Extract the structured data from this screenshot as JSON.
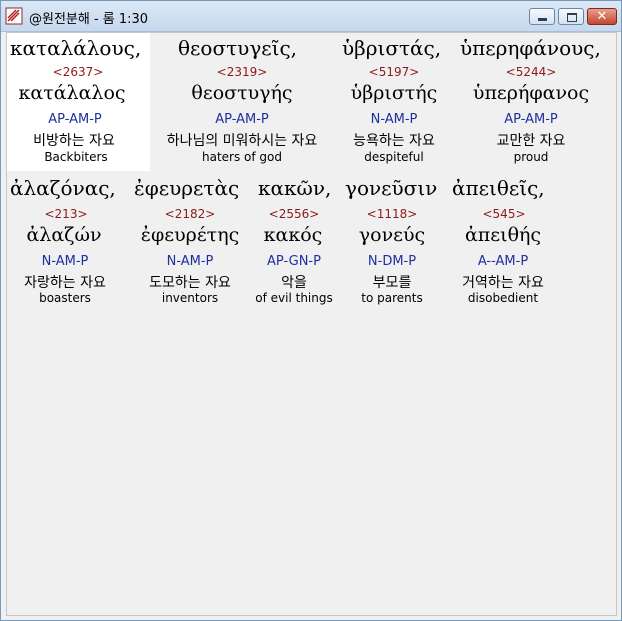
{
  "window": {
    "title": "@원전분해 - 롬 1:30",
    "close_glyph": "✕"
  },
  "words": [
    {
      "greek": "καταλάλους,",
      "strong": "<2637>",
      "lemma": "κατάλαλος",
      "morph": "AP-AM-P",
      "korean": "비방하는 자요",
      "english": "Backbiters"
    },
    {
      "greek": "θεοστυγεῖς,",
      "strong": "<2319>",
      "lemma": "θεοστυγής",
      "morph": "AP-AM-P",
      "korean": "하나님의 미워하시는 자요",
      "english": "haters of god"
    },
    {
      "greek": "ὑβριστάς,",
      "strong": "<5197>",
      "lemma": "ὑβριστής",
      "morph": "N-AM-P",
      "korean": "능욕하는 자요",
      "english": "despiteful"
    },
    {
      "greek": "ὑπερηφάνους,",
      "strong": "<5244>",
      "lemma": "ὑπερήφανος",
      "morph": "AP-AM-P",
      "korean": "교만한 자요",
      "english": "proud"
    },
    {
      "greek": "ἀλαζόνας,",
      "strong": "<213>",
      "lemma": "ἀλαζών",
      "morph": "N-AM-P",
      "korean": "자랑하는 자요",
      "english": "boasters"
    },
    {
      "greek": "ἐφευρετὰς",
      "strong": "<2182>",
      "lemma": "ἐφευρέτης",
      "morph": "N-AM-P",
      "korean": "도모하는 자요",
      "english": "inventors"
    },
    {
      "greek": "κακῶν,",
      "strong": "<2556>",
      "lemma": "κακός",
      "morph": "AP-GN-P",
      "korean": "악을",
      "english": "of evil things"
    },
    {
      "greek": "γονεῦσιν",
      "strong": "<1118>",
      "lemma": "γονεύς",
      "morph": "N-DM-P",
      "korean": "부모를",
      "english": "to parents"
    },
    {
      "greek": "ἀπειθεῖς,",
      "strong": "<545>",
      "lemma": "ἀπειθής",
      "morph": "A--AM-P",
      "korean": "거역하는 자요",
      "english": "disobedient"
    }
  ]
}
